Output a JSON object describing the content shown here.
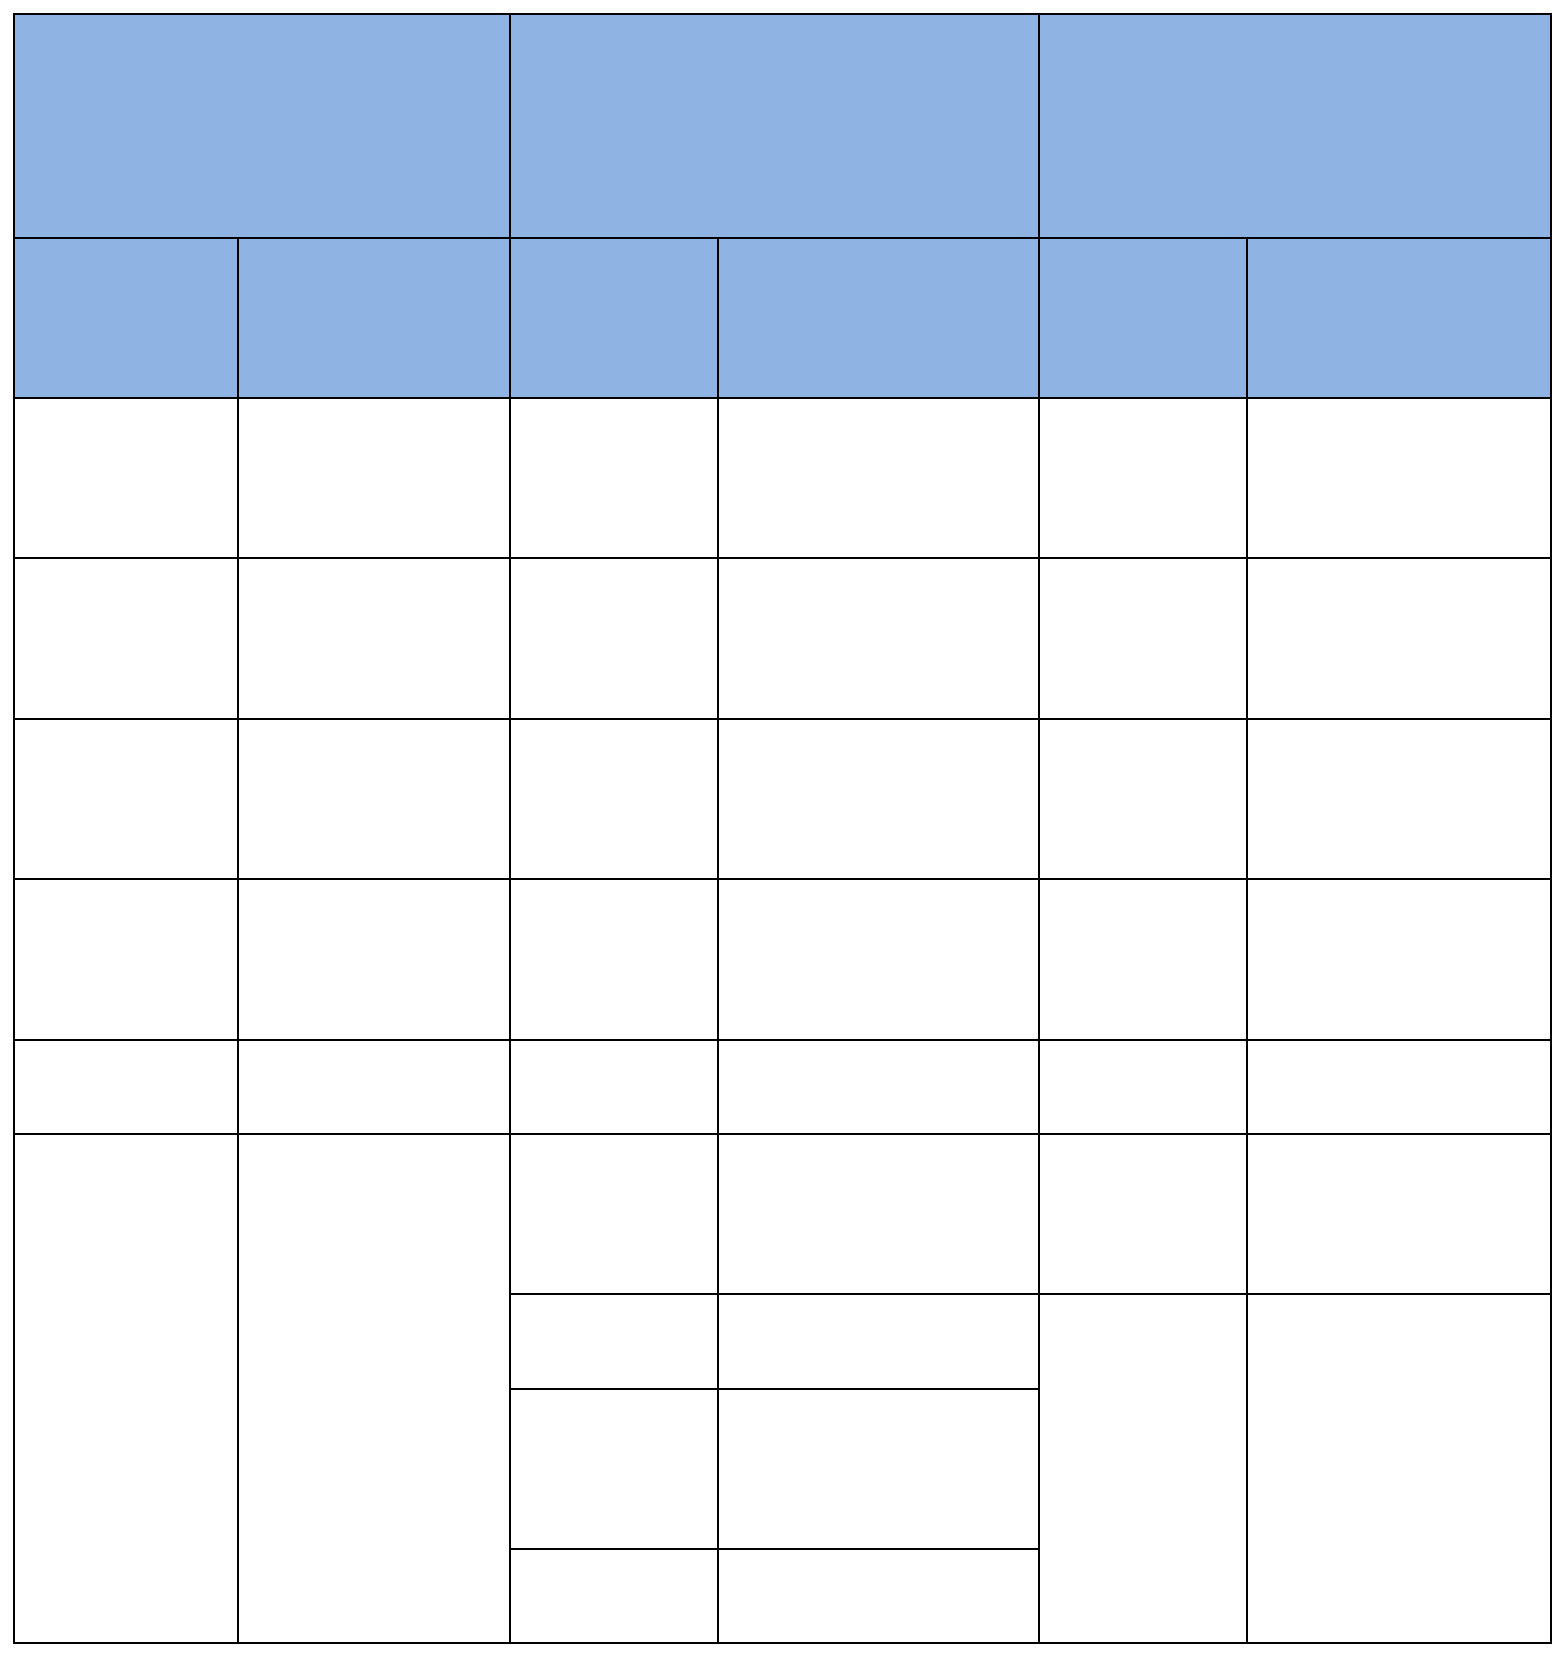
{
  "colors": {
    "header_fill": "#8fb3e3",
    "body_fill": "#ffffff",
    "border": "#000000"
  },
  "table": {
    "group_headers": [
      "",
      "",
      ""
    ],
    "sub_headers": [
      "",
      "",
      "",
      "",
      "",
      ""
    ],
    "rows": [
      [
        "",
        "",
        "",
        "",
        "",
        ""
      ],
      [
        "",
        "",
        "",
        "",
        "",
        ""
      ],
      [
        "",
        "",
        "",
        "",
        "",
        ""
      ],
      [
        "",
        "",
        "",
        "",
        "",
        ""
      ],
      [
        "",
        "",
        "",
        "",
        "",
        ""
      ]
    ],
    "final_block": {
      "col1": "",
      "col2": "",
      "sub_rows": [
        {
          "col3": "",
          "col4": "",
          "col5": "",
          "col6": ""
        },
        {
          "col3": "",
          "col4": ""
        },
        {
          "col3": "",
          "col4": ""
        },
        {
          "col3": "",
          "col4": ""
        }
      ],
      "merged_col5": "",
      "merged_col6": ""
    }
  }
}
